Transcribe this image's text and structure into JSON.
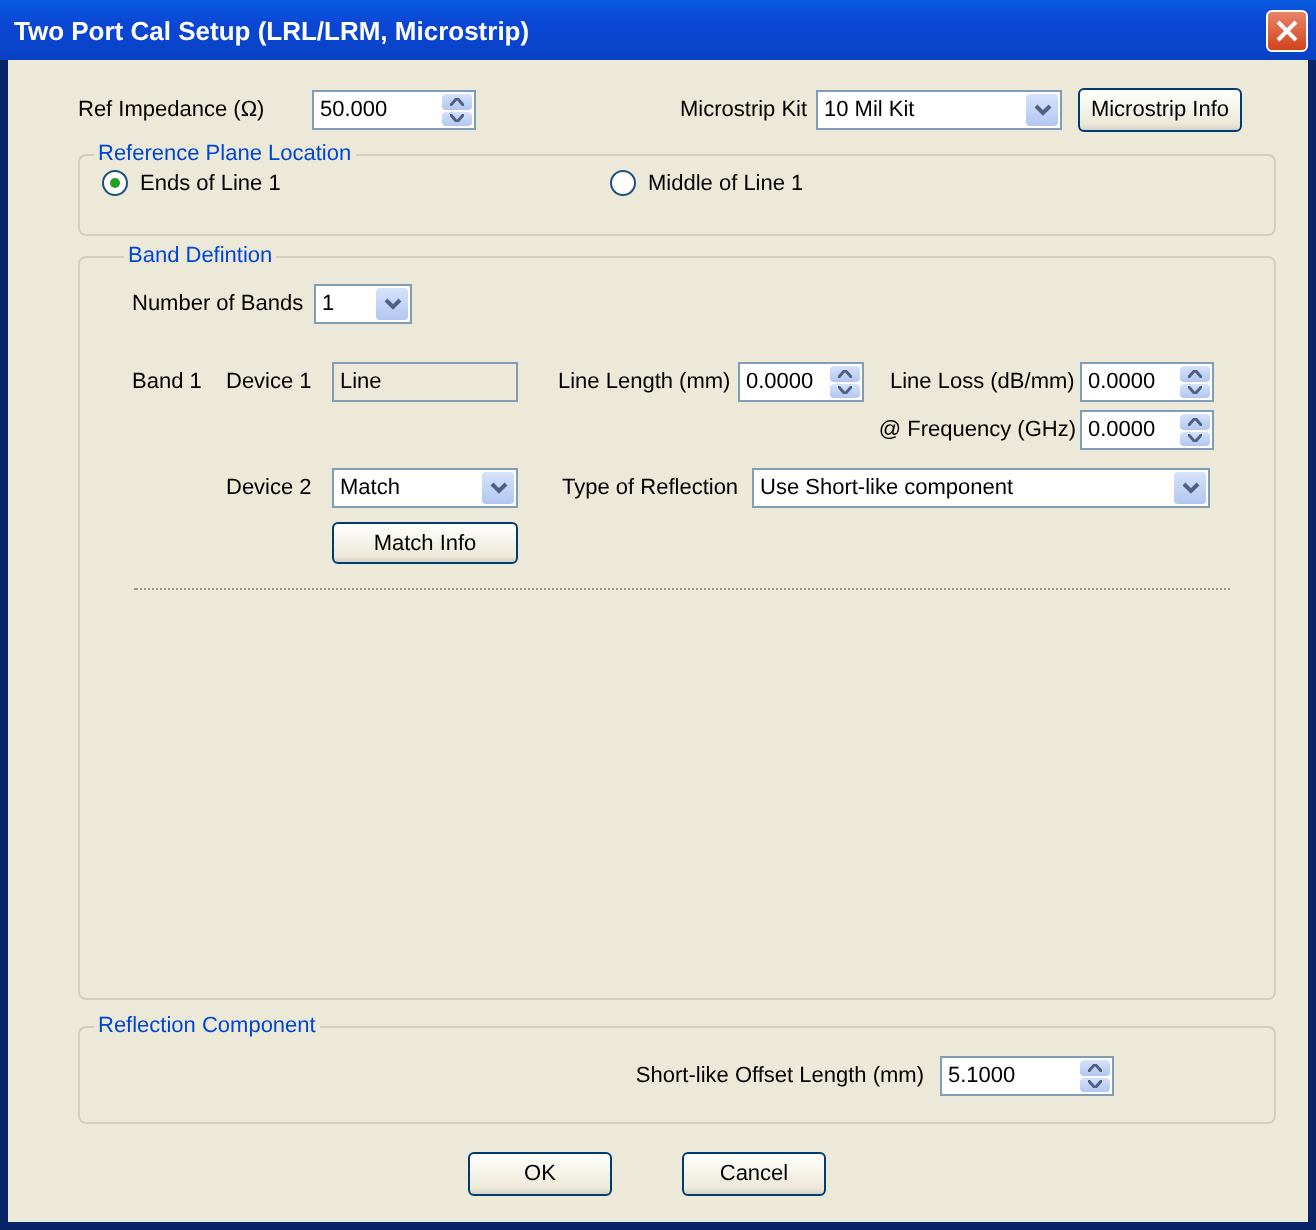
{
  "window": {
    "title": "Two Port Cal Setup (LRL/LRM, Microstrip)"
  },
  "ref_impedance": {
    "label": "Ref Impedance (Ω)",
    "value": "50.000"
  },
  "microstrip_kit": {
    "label": "Microstrip Kit",
    "value": "10 Mil Kit"
  },
  "microstrip_info_button": "Microstrip Info",
  "reference_plane": {
    "title": "Reference Plane Location",
    "options": [
      {
        "label": "Ends of Line 1",
        "selected": true
      },
      {
        "label": "Middle of Line 1",
        "selected": false
      }
    ]
  },
  "band_definition": {
    "title": "Band Defintion",
    "number_of_bands": {
      "label": "Number of Bands",
      "value": "1"
    },
    "bands": [
      {
        "label": "Band 1",
        "device_1": {
          "label": "Device 1",
          "value": "Line"
        },
        "line_length": {
          "label": "Line Length (mm)",
          "value": "0.0000"
        },
        "line_loss": {
          "label": "Line Loss (dB/mm)",
          "value": "0.0000"
        },
        "frequency": {
          "label": "@ Frequency (GHz)",
          "value": "0.0000"
        },
        "device_2": {
          "label": "Device 2",
          "value": "Match"
        },
        "type_of_reflection": {
          "label": "Type of Reflection",
          "value": "Use Short-like component"
        },
        "match_info_button": "Match Info"
      }
    ]
  },
  "reflection_component": {
    "title": "Reflection Component",
    "offset_length": {
      "label": "Short-like Offset Length (mm)",
      "value": "5.1000"
    }
  },
  "buttons": [
    "OK",
    "Cancel"
  ]
}
